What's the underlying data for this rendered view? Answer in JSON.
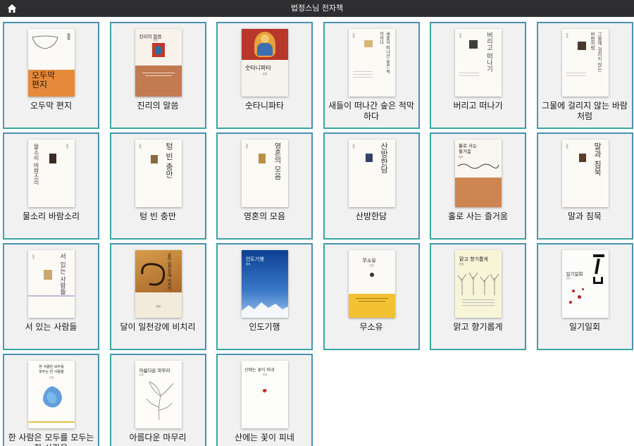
{
  "header": {
    "title": "법정스님 전자책",
    "home_icon": "home-icon"
  },
  "colors": {
    "topbar": "#2e2e30",
    "card_border": "#4a90b0",
    "card_background": "#f1f1f1"
  },
  "books": [
    {
      "title": "오두막 편지",
      "cover_text": "오두막\n편지",
      "cover_small": "법정"
    },
    {
      "title": "진리의 말씀",
      "cover_text": "진리의 말씀",
      "cover_small": "법정"
    },
    {
      "title": "숫타니파타",
      "cover_text": "숫타니파타",
      "cover_small": "법정"
    },
    {
      "title": "새들이 떠나간 숲은 적막하다",
      "cover_text": "새들이 떠나간 숲은 적막하다",
      "cover_small": "법정"
    },
    {
      "title": "버리고 떠나기",
      "cover_text": "버리고 떠나기",
      "cover_small": "법정"
    },
    {
      "title": "그물에 걸리지 않는 바람처럼",
      "cover_text": "그물에 걸리지 않는 바람처럼",
      "cover_small": "법정"
    },
    {
      "title": "물소리 바람소리",
      "cover_text": "물소리 바람소리",
      "cover_small": "법정"
    },
    {
      "title": "텅 빈 충만",
      "cover_text": "텅 빈 충만",
      "cover_small": "법정"
    },
    {
      "title": "영혼의 모음",
      "cover_text": "영혼의 모음",
      "cover_small": "법정"
    },
    {
      "title": "산방한담",
      "cover_text": "산방한담",
      "cover_small": "법정"
    },
    {
      "title": "홀로 사는 즐거움",
      "cover_text": "홀로 사는\n즐거움",
      "cover_small": "법정"
    },
    {
      "title": "말과 침묵",
      "cover_text": "말과 침묵",
      "cover_small": "법정"
    },
    {
      "title": "서 있는 사람들",
      "cover_text": "서 있는 사람들",
      "cover_small": "법정"
    },
    {
      "title": "달이 일천강에 비치리",
      "cover_text": "달이 일천강에 비치리",
      "cover_small": "법정"
    },
    {
      "title": "인도기행",
      "cover_text": "인도기행",
      "cover_small": "법정"
    },
    {
      "title": "무소유",
      "cover_text": "무소유",
      "cover_small": "법정"
    },
    {
      "title": "맑고 향기롭게",
      "cover_text": "맑고 향기롭게",
      "cover_small": "법정"
    },
    {
      "title": "일기일회",
      "cover_text": "일기일회",
      "cover_small": "법정"
    },
    {
      "title": "한 사람은 모두를 모두는 한 사람을",
      "cover_text": "한 사람은 모두를\n모두는 한 사람을",
      "cover_small": "법정"
    },
    {
      "title": "아름다운 마무리",
      "cover_text": "아름다운 마무리",
      "cover_small": "법정"
    },
    {
      "title": "산에는 꽃이 피네",
      "cover_text": "산에는 꽃이 피네",
      "cover_small": "법정"
    }
  ]
}
